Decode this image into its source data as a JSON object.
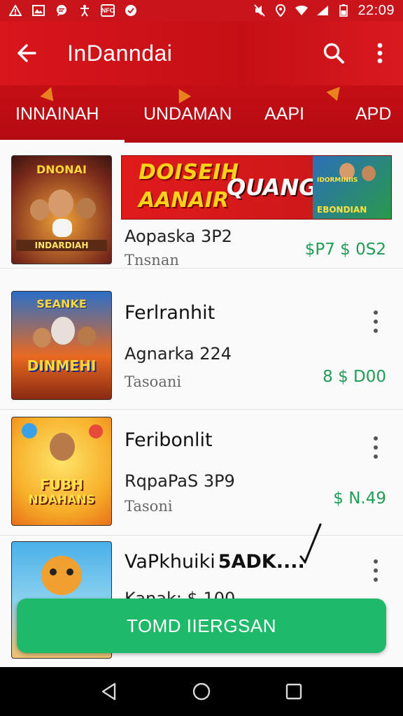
{
  "status_bar": {
    "time": "22:09",
    "left_icons": [
      "warning-icon",
      "gallery-icon",
      "chat-icon",
      "accessibility-icon",
      "nfc-icon",
      "check-circle-icon"
    ],
    "right_icons": [
      "mute-icon",
      "location-icon",
      "wifi-icon",
      "signal-icon",
      "battery-icon"
    ]
  },
  "app_bar": {
    "title": "InDanndai",
    "icons": [
      "back-arrow-icon",
      "search-icon",
      "more-vert-icon"
    ]
  },
  "tabs": [
    {
      "label": "INNAINAH",
      "selected": true
    },
    {
      "label": "UNDAMAN",
      "selected": false
    },
    {
      "label": "AAPI",
      "selected": false
    },
    {
      "label": "APD",
      "selected": false
    }
  ],
  "colors": {
    "accent": "#c8141a",
    "price_green": "#1f9c55",
    "install_green": "#1fb96a"
  },
  "banner": {
    "line1": "DOISEIH",
    "line2": "AANAIR",
    "line3": "QUANG",
    "art_title": "IDORMINIIS",
    "art_label": "EBONDIAN"
  },
  "items": [
    {
      "thumb_title": "DNONAI",
      "thumb_subtitle": "INDARDIAH",
      "sub": "Aopaska 3P2",
      "meta": "Tnsnan",
      "price": "$P7 $ 0S2"
    },
    {
      "thumb_title": "SEANKE",
      "thumb_subtitle": "DINMEHI",
      "name": "Ferlranhit",
      "sub": "Agnarka 224",
      "meta": "Tasoani",
      "price": "8 $ D00"
    },
    {
      "thumb_title": "FUBH",
      "thumb_subtitle": "NDAHANS",
      "name": "Feribonlit",
      "sub": "RqpaPaS 3P9",
      "meta": "Tasoni",
      "price": "$ N.49"
    },
    {
      "name": "VaPkhuiki",
      "name_overlay": "5ADK....",
      "sub": "Kanak: $ 100"
    }
  ],
  "install_button": {
    "label": "TOMD IIERGSAN"
  },
  "nav_bar": {
    "icons": [
      "back-triangle-icon",
      "home-circle-icon",
      "recents-square-icon"
    ]
  }
}
